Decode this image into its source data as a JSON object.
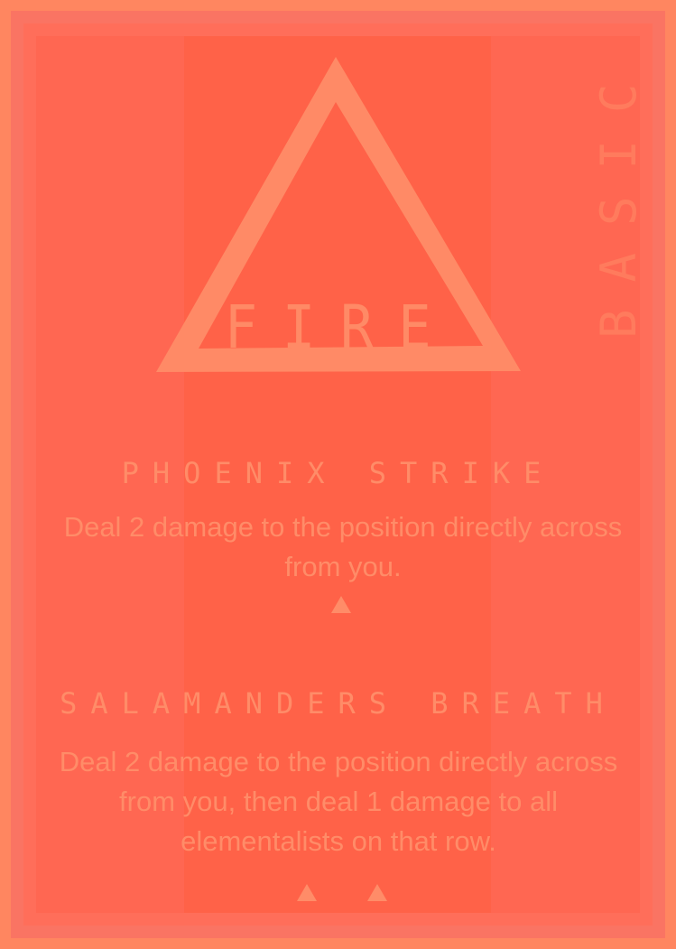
{
  "card": {
    "element": "FIRE",
    "rarity": "BASIC",
    "colors": {
      "border": "#ff8660",
      "panel": "#ff6752",
      "ink": "#ff8c68",
      "rarity_ink": "#ff7b5d"
    },
    "element_icon": "triangle-icon",
    "abilities": [
      {
        "name": "PHOENIX STRIKE",
        "text": "Deal 2 damage to the position directly across from you.",
        "cost": 1,
        "cost_icon": "triangle-pip-icon"
      },
      {
        "name": "SALAMANDERS BREATH",
        "text": "Deal 2 damage to the position directly across from you, then deal 1 damage to all elementalists on that row.",
        "cost": 2,
        "cost_icon": "triangle-pip-icon"
      }
    ]
  }
}
